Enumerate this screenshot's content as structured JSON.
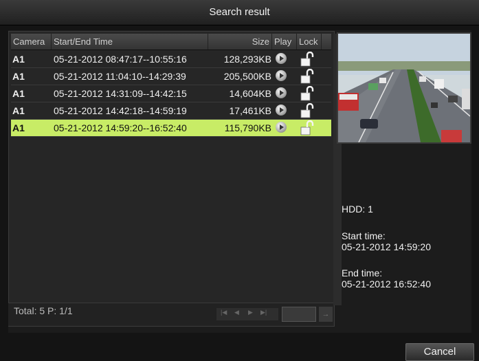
{
  "window": {
    "title": "Search result"
  },
  "table": {
    "headers": {
      "camera": "Camera",
      "time": "Start/End Time",
      "size": "Size",
      "play": "Play",
      "lock": "Lock"
    },
    "rows": [
      {
        "camera": "A1",
        "time": "05-21-2012 08:47:17--10:55:16",
        "size": "128,293KB",
        "play_icon": "play-icon",
        "lock_icon": "unlocked-icon"
      },
      {
        "camera": "A1",
        "time": "05-21-2012 11:04:10--14:29:39",
        "size": "205,500KB",
        "play_icon": "play-icon",
        "lock_icon": "unlocked-icon"
      },
      {
        "camera": "A1",
        "time": "05-21-2012 14:31:09--14:42:15",
        "size": "14,604KB",
        "play_icon": "play-icon",
        "lock_icon": "unlocked-icon"
      },
      {
        "camera": "A1",
        "time": "05-21-2012 14:42:18--14:59:19",
        "size": "17,461KB",
        "play_icon": "play-icon",
        "lock_icon": "unlocked-icon"
      },
      {
        "camera": "A1",
        "time": "05-21-2012 14:59:20--16:52:40",
        "size": "115,790KB",
        "play_icon": "play-icon",
        "lock_icon": "unlocked-icon"
      }
    ],
    "selected_row": 4,
    "selected_color": "#c8ec66"
  },
  "footer": {
    "total": "Total: 5  P: 1/1"
  },
  "details": {
    "hdd": "HDD: 1",
    "start_label": "Start time:",
    "start_value": "05-21-2012 14:59:20",
    "end_label": "End time:",
    "end_value": "05-21-2012 16:52:40"
  },
  "buttons": {
    "cancel": "Cancel"
  }
}
